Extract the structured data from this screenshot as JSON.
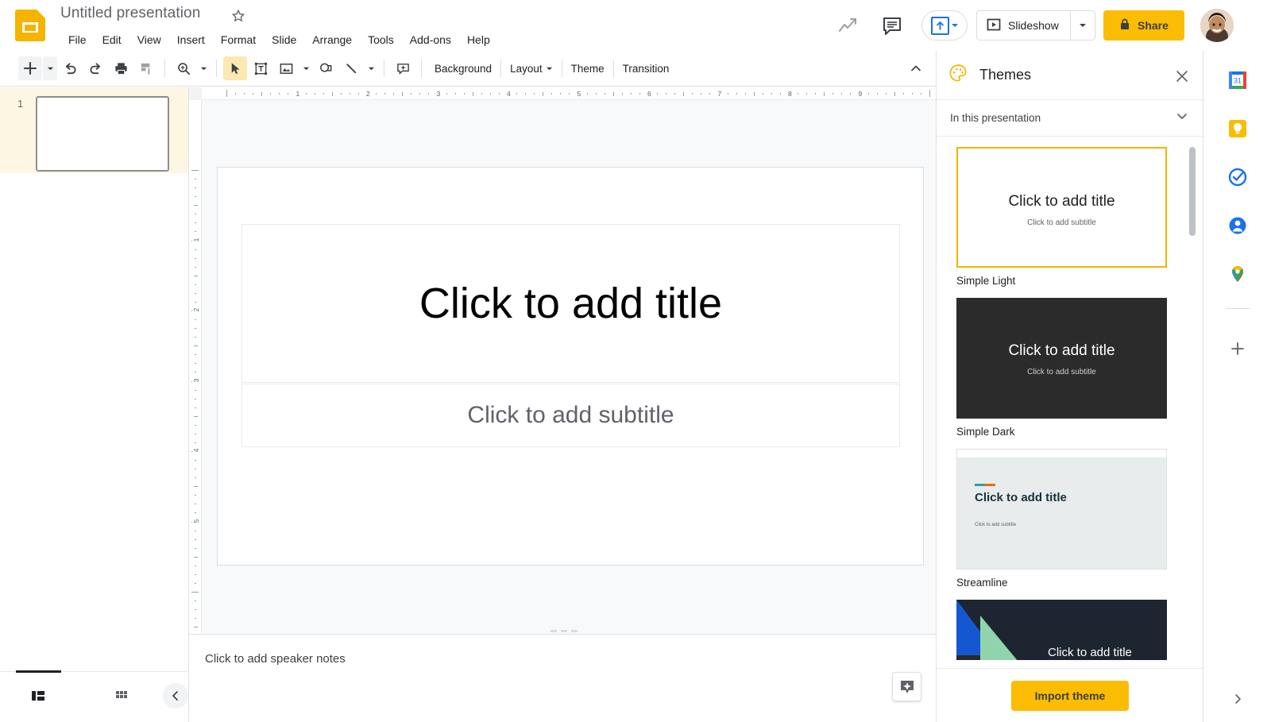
{
  "app": {
    "logo_icon": "slides-logo-icon",
    "title": "Untitled presentation",
    "star_icon": "star-icon"
  },
  "menubar": {
    "items": [
      {
        "label": "File"
      },
      {
        "label": "Edit"
      },
      {
        "label": "View"
      },
      {
        "label": "Insert"
      },
      {
        "label": "Format"
      },
      {
        "label": "Slide"
      },
      {
        "label": "Arrange"
      },
      {
        "label": "Tools"
      },
      {
        "label": "Add-ons"
      },
      {
        "label": "Help"
      }
    ]
  },
  "topbar_actions": {
    "trending_icon": "trending-up-icon",
    "comment_icon": "comment-icon",
    "present_icon": "present-to-meeting-icon",
    "slideshow_label": "Slideshow",
    "slideshow_icon": "play-box-icon",
    "share_label": "Share",
    "share_lock_icon": "lock-icon",
    "avatar": "user-avatar"
  },
  "toolbar": {
    "new_slide_icon": "add-slide-icon",
    "undo_icon": "undo-icon",
    "redo_icon": "redo-icon",
    "print_icon": "print-icon",
    "paint_format_icon": "paint-format-icon",
    "zoom_icon": "zoom-icon",
    "select_icon": "select-cursor-icon",
    "textbox_icon": "text-box-icon",
    "image_icon": "insert-image-icon",
    "shape_icon": "shape-icon",
    "line_icon": "line-icon",
    "comment_icon": "add-comment-icon",
    "background_label": "Background",
    "layout_label": "Layout",
    "theme_label": "Theme",
    "transition_label": "Transition",
    "collapse_icon": "chevron-up-icon"
  },
  "filmstrip": {
    "slides": [
      {
        "number": "1",
        "selected": true
      }
    ]
  },
  "editor": {
    "ruler_h_labels": [
      "1",
      "2",
      "3",
      "4",
      "5",
      "6",
      "7",
      "8",
      "9"
    ],
    "ruler_v_labels": [
      "1",
      "2",
      "3",
      "4",
      "5"
    ],
    "slide": {
      "title_placeholder": "Click to add title",
      "subtitle_placeholder": "Click to add subtitle"
    }
  },
  "notes": {
    "placeholder": "Click to add speaker notes",
    "explore_icon": "explore-icon"
  },
  "bottombar": {
    "filmstrip_view_icon": "filmstrip-view-icon",
    "grid_view_icon": "grid-view-icon",
    "collapse_icon": "chevron-left-icon"
  },
  "themes_panel": {
    "palette_icon": "palette-icon",
    "title": "Themes",
    "close_icon": "close-icon",
    "section_label": "In this presentation",
    "section_chevron_icon": "chevron-down-icon",
    "themes": [
      {
        "name": "Simple Light",
        "selected": true,
        "style": "light",
        "title_text": "Click to add title",
        "subtitle_text": "Click to add subtitle"
      },
      {
        "name": "Simple Dark",
        "selected": false,
        "style": "dark",
        "title_text": "Click to add title",
        "subtitle_text": "Click to add subtitle"
      },
      {
        "name": "Streamline",
        "selected": false,
        "style": "streamline",
        "title_text": "Click to add title",
        "subtitle_text": "Click to add subtitle"
      },
      {
        "name": "",
        "selected": false,
        "style": "geo",
        "title_text": "Click to add title",
        "subtitle_text": ""
      }
    ],
    "import_label": "Import theme"
  },
  "rail": {
    "items": [
      {
        "icon": "google-calendar-icon"
      },
      {
        "icon": "google-keep-icon"
      },
      {
        "icon": "google-tasks-icon"
      },
      {
        "icon": "google-contacts-icon"
      },
      {
        "icon": "google-maps-icon"
      }
    ],
    "add_icon": "add-icon",
    "expand_icon": "chevron-right-icon"
  },
  "colors": {
    "brand_yellow": "#F4B400",
    "share_yellow": "#FBBC04",
    "accent_blue": "#1a73e8",
    "selected_row": "#fdf6e3"
  }
}
